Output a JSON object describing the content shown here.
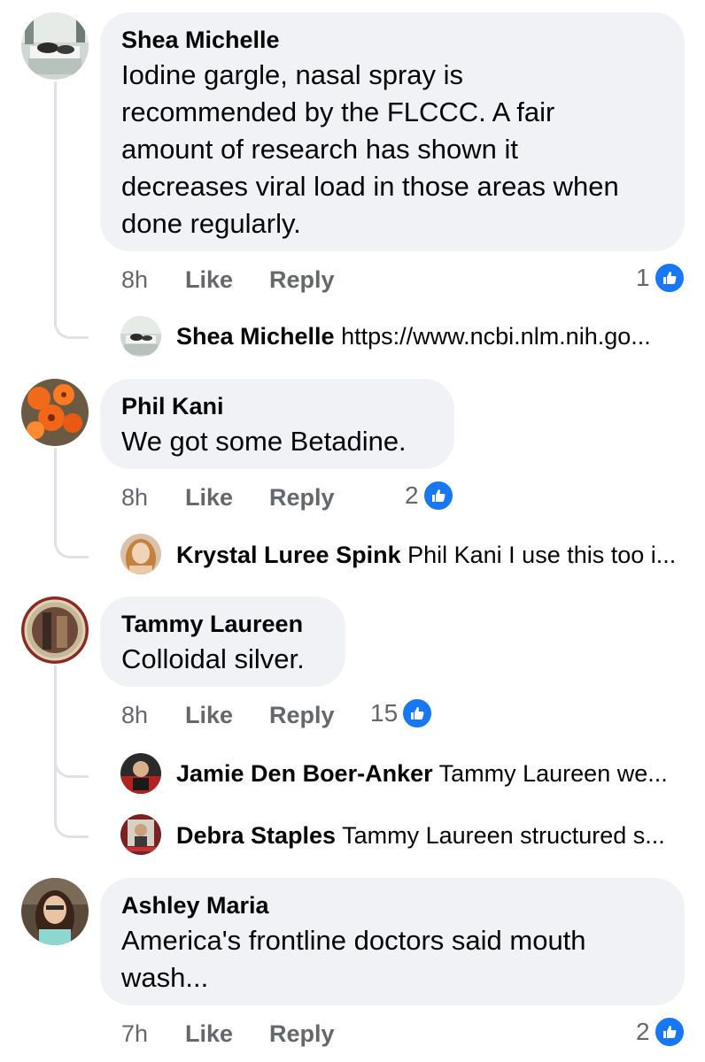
{
  "comments": [
    {
      "author": "Shea Michelle",
      "lines": [
        "Iodine gargle, nasal spray is",
        "recommended by the FLCCC. A fair",
        "amount of research has shown it",
        "decreases viral load in those areas when",
        "done regularly."
      ],
      "time": "8h",
      "like_label": "Like",
      "reply_label": "Reply",
      "reactions": "1",
      "replies": [
        {
          "author": "Shea Michelle",
          "text": "https://www.ncbi.nlm.nih.go..."
        }
      ]
    },
    {
      "author": "Phil Kani",
      "lines": [
        "We got some Betadine."
      ],
      "time": "8h",
      "like_label": "Like",
      "reply_label": "Reply",
      "reactions": "2",
      "replies": [
        {
          "author": "Krystal Luree Spink",
          "text": "Phil Kani I use this too i..."
        }
      ]
    },
    {
      "author": "Tammy Laureen",
      "lines": [
        "Colloidal silver."
      ],
      "time": "8h",
      "like_label": "Like",
      "reply_label": "Reply",
      "reactions": "15",
      "replies": [
        {
          "author": "Jamie Den Boer-Anker",
          "text": "Tammy Laureen we..."
        },
        {
          "author": "Debra Staples",
          "text": "Tammy Laureen structured s..."
        }
      ]
    },
    {
      "author": "Ashley Maria",
      "lines": [
        "America's frontline doctors said mouth",
        "wash..."
      ],
      "time": "7h",
      "like_label": "Like",
      "reply_label": "Reply",
      "reactions": "2",
      "replies": []
    }
  ],
  "colors": {
    "bubble": "#f0f2f5",
    "meta": "#65676b",
    "like_badge": "#1877f2",
    "thread_line": "#dfe1e5"
  },
  "icons": {
    "like_badge": "thumbs-up-icon"
  }
}
